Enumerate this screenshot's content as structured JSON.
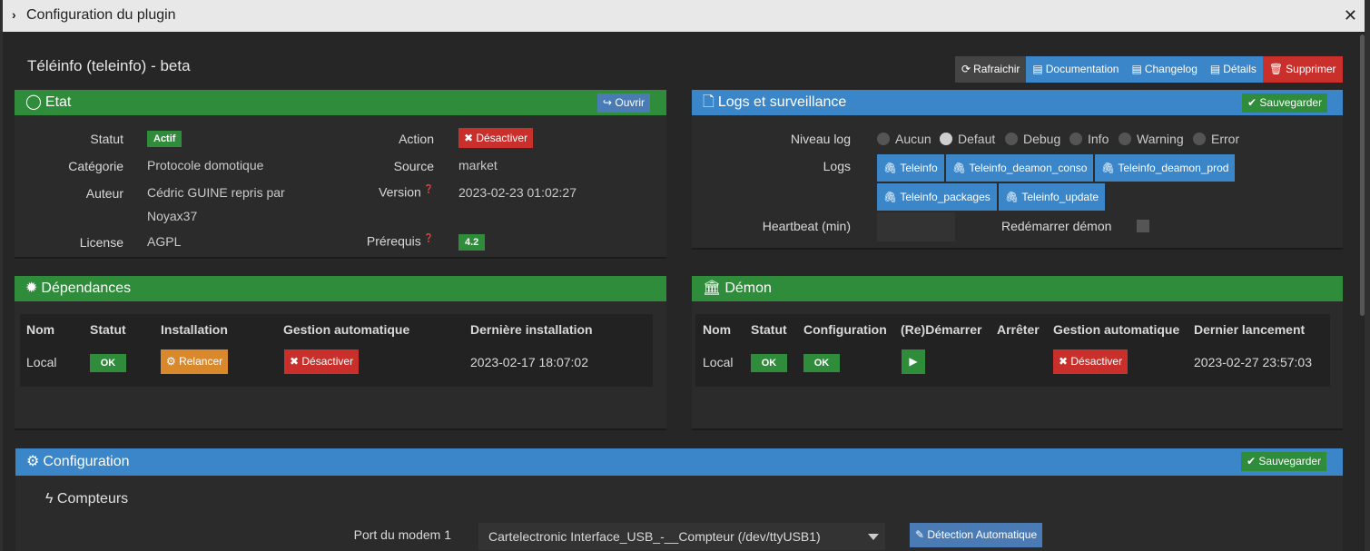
{
  "window": {
    "title": "Configuration du plugin",
    "close": "✕"
  },
  "plugin": {
    "title": "Téléinfo (teleinfo) - beta"
  },
  "toolbar": {
    "refresh": "Rafraichir",
    "documentation": "Documentation",
    "changelog": "Changelog",
    "details": "Détails",
    "delete": "Supprimer"
  },
  "etat": {
    "title": "Etat",
    "open": "Ouvrir",
    "statut_label": "Statut",
    "statut_value": "Actif",
    "categorie_label": "Catégorie",
    "categorie_value": "Protocole domotique",
    "auteur_label": "Auteur",
    "auteur_value_1": "Cédric GUINE repris par",
    "auteur_value_2": "Noyax37",
    "license_label": "License",
    "license_value": "AGPL",
    "action_label": "Action",
    "action_button": "Désactiver",
    "source_label": "Source",
    "source_value": "market",
    "version_label": "Version",
    "version_value": "2023-02-23 01:02:27",
    "prerequis_label": "Prérequis",
    "prerequis_value": "4.2"
  },
  "logs": {
    "title": "Logs et surveillance",
    "save": "Sauvegarder",
    "niveau_label": "Niveau log",
    "levels": [
      "Aucun",
      "Defaut",
      "Debug",
      "Info",
      "Warning",
      "Error"
    ],
    "selected_level": "Defaut",
    "logs_label": "Logs",
    "files": [
      "Teleinfo",
      "Teleinfo_deamon_conso",
      "Teleinfo_deamon_prod",
      "Teleinfo_packages",
      "Teleinfo_update"
    ],
    "heartbeat_label": "Heartbeat (min)",
    "heartbeat_value": "",
    "restart_label": "Redémarrer démon"
  },
  "dependances": {
    "title": "Dépendances",
    "headers": [
      "Nom",
      "Statut",
      "Installation",
      "Gestion automatique",
      "Dernière installation"
    ],
    "row": {
      "nom": "Local",
      "statut": "OK",
      "installation": "Relancer",
      "gestion": "Désactiver",
      "derniere": "2023-02-17 18:07:02"
    }
  },
  "demon": {
    "title": "Démon",
    "headers": [
      "Nom",
      "Statut",
      "Configuration",
      "(Re)Démarrer",
      "Arrêter",
      "Gestion automatique",
      "Dernier lancement"
    ],
    "row": {
      "nom": "Local",
      "statut": "OK",
      "configuration": "OK",
      "gestion": "Désactiver",
      "dernier": "2023-02-27 23:57:03"
    }
  },
  "configuration": {
    "title": "Configuration",
    "save": "Sauvegarder",
    "section": "Compteurs",
    "port_label": "Port du modem 1",
    "port_value": "Cartelectronic Interface_USB_-__Compteur (/dev/ttyUSB1)",
    "detect": "Détection Automatique"
  },
  "colors": {
    "green": "#2f8c3a",
    "blue": "#3a86c8",
    "red": "#c9302c",
    "orange": "#d9892b",
    "steel": "#4a7bb5"
  }
}
